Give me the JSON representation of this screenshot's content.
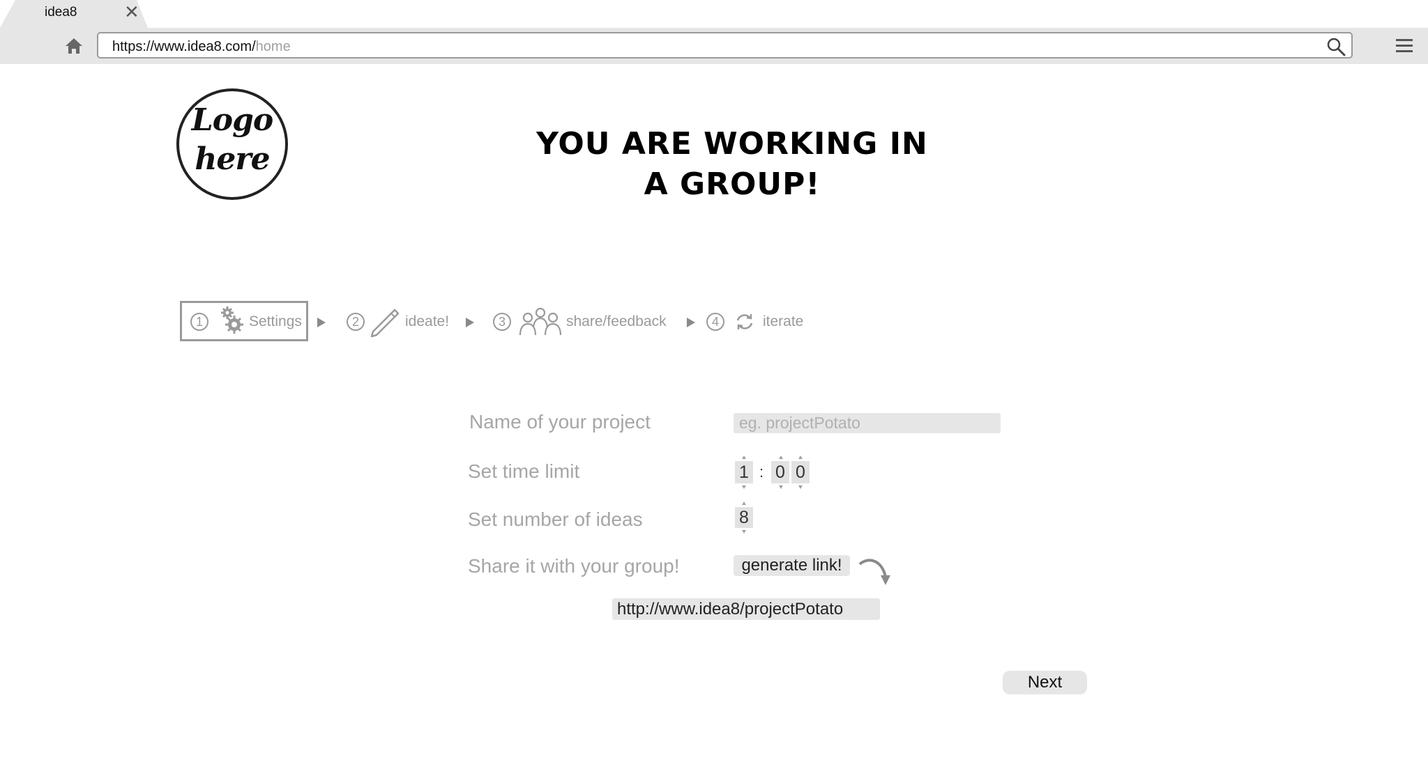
{
  "browser": {
    "tab_title": "idea8",
    "url_base": "https://www.idea8.com/",
    "url_path": "home"
  },
  "logo": {
    "line1": "Logo",
    "line2": "here"
  },
  "heading": {
    "line1": "YOU ARE WORKING IN",
    "line2": "A GROUP!"
  },
  "steps": [
    {
      "number": "1",
      "label": "Settings",
      "icon": "gear-icon",
      "active": true
    },
    {
      "number": "2",
      "label": "ideate!",
      "icon": "pencil-icon",
      "active": false
    },
    {
      "number": "3",
      "label": "share/feedback",
      "icon": "group-icon",
      "active": false
    },
    {
      "number": "4",
      "label": "iterate",
      "icon": "refresh-icon",
      "active": false
    }
  ],
  "form": {
    "project_name_label": "Name of your project",
    "project_name_placeholder": "eg. projectPotato",
    "time_limit_label": "Set time limit",
    "time_hours": "1",
    "time_minutes_tens": "0",
    "time_minutes_ones": "0",
    "ideas_label": "Set number of ideas",
    "ideas_count": "8",
    "share_label": "Share it with your group!",
    "generate_button": "generate link!",
    "generated_link": "http://www.idea8/projectPotato"
  },
  "next_button": "Next",
  "colors": {
    "chrome": "#e6e6e6",
    "muted_text": "#a6a6a6",
    "border": "#9a9a9a"
  }
}
